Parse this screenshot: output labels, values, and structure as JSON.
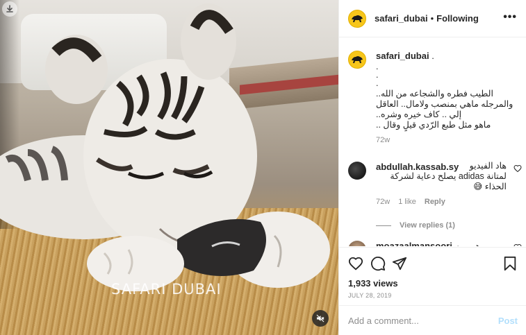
{
  "post": {
    "watermark": "SAFARI DUBAI",
    "username": "safari_dubai",
    "separator": "•",
    "follow_status": "Following",
    "more_label": "•••"
  },
  "caption": {
    "username": "safari_dubai",
    "username_suffix": ".",
    "dots": ".\n.\n.",
    "text": "الطيب فطره والشجاعه من الله..\nوالمرجله ماهي بمنصب ولامال.. العاقل\nإلي .. كاف خيره وشره..\nماهو مثل طبع الرّدي قيلٍ وقال ..",
    "time": "72w"
  },
  "comments": [
    {
      "username": "abdullah.kassab.sy",
      "text": "هاد الفيديو\nلمتانة adidas يصلح دعاية لشركة\nالحذاء 😅",
      "time": "72w",
      "likes": "1 like",
      "reply": "Reply",
      "view_replies": "View replies (1)"
    },
    {
      "username": "moazaalmansoori",
      "text": "هههههه"
    }
  ],
  "stats": {
    "views": "1,933 views",
    "date": "JULY 28, 2019"
  },
  "composer": {
    "placeholder": "Add a comment...",
    "post_label": "Post"
  },
  "colors": {
    "brand_avatar": "#f7c61b",
    "link_blue_disabled": "#b2dffc",
    "muted_text": "#8e8e8e"
  },
  "icons": {
    "download": "download-icon",
    "mute": "muted-speaker-icon",
    "like": "heart-icon",
    "comment": "comment-bubble-icon",
    "share": "paper-plane-icon",
    "save": "bookmark-icon",
    "more": "more-options-icon"
  }
}
